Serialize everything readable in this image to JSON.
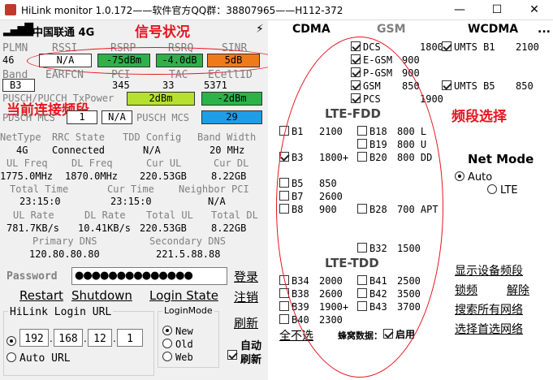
{
  "window": {
    "title": "HiLink monitor 1.0.172——软件官方QQ群：38807965——H112-372",
    "minimize": "—",
    "maximize": "☐",
    "close": "✕"
  },
  "status": {
    "signal": "▂▄▆█",
    "carrier": "中国联通 4G",
    "lightning": "⚡"
  },
  "annotations": {
    "signal": "信号状况",
    "band_current": "当前连接频段",
    "band_select": "频段选择"
  },
  "labels": {
    "plmn": "PLMN",
    "rssi": "RSSI",
    "rsrp": "RSRP",
    "rsrq": "RSRQ",
    "sinr": "SINR",
    "band": "Band",
    "earfcn": "EARFCN",
    "pci": "PCI",
    "tac": "TAC",
    "ecellid": "ECellID",
    "txpower": "PUSCH/PUCCH TxPower",
    "pdsch_mcs": "PDSCH MCS",
    "pusch_mcs": "PUSCH MCS",
    "nettype": "NetType",
    "rrc": "RRC State",
    "tdd": "TDD Config",
    "bandwidth": "Band Width",
    "ul_freq": "UL Freq",
    "dl_freq": "DL Freq",
    "cur_ul": "Cur UL",
    "cur_dl": "Cur DL",
    "total_time": "Total Time",
    "cur_time": "Cur Time",
    "neighbor": "Neighbor PCI",
    "ul_rate": "UL Rate",
    "dl_rate": "DL Rate",
    "total_ul": "Total UL",
    "total_dl": "Total DL",
    "primary_dns": "Primary DNS",
    "secondary_dns": "Secondary DNS",
    "password": "Password",
    "login_url": "HiLink Login URL",
    "login_mode": "LoginMode"
  },
  "values": {
    "plmn": "46",
    "rssi": "N/A",
    "rsrp": "-75dBm",
    "rsrq": "-4.0dB",
    "sinr": "5dB",
    "band": "B3",
    "earfcn": "",
    "pci": "345",
    "tac": "33",
    "ecellid": "5371",
    "tx1": "2dBm",
    "tx2": "-2dBm",
    "pdsch1": "1",
    "pdsch2": "N/A",
    "pusch_mcs": "29",
    "nettype": "4G",
    "rrc": "Connected",
    "tdd": "N/A",
    "bandwidth": "20 MHz",
    "ul_freq": "1775.0MHz",
    "dl_freq": "1870.0MHz",
    "cur_ul": "220.53GB",
    "cur_dl": "8.22GB",
    "total_time": "23:15:0",
    "cur_time": "23:15:0",
    "neighbor": "N/A",
    "ul_rate": "781.7KB/s",
    "dl_rate": "10.41KB/s",
    "total_ul": "220.53GB",
    "total_dl": "8.22GB",
    "primary_dns": "120.80.80.80",
    "secondary_dns": "221.5.88.88",
    "password": "●●●●●●●●●●●●●●",
    "ip1": "192",
    "ip2": "168",
    "ip3": "12",
    "ip4": "1"
  },
  "buttons": {
    "login": "登录",
    "logout": "注销",
    "refresh": "刷新",
    "auto_refresh": "自动刷新",
    "restart": "Restart",
    "shutdown": "Shutdown",
    "login_state": "Login State",
    "url_manual": "",
    "url_auto": "Auto URL",
    "mode_new": "New",
    "mode_old": "Old",
    "mode_web": "Web"
  },
  "right": {
    "cdma": "CDMA",
    "gsm": "GSM",
    "wcdma": "WCDMA",
    "more": "...",
    "gsm_bands": [
      {
        "name": "DCS",
        "freq": "1800"
      },
      {
        "name": "E-GSM",
        "freq": "900"
      },
      {
        "name": "P-GSM",
        "freq": "900"
      },
      {
        "name": "GSM",
        "freq": "850"
      },
      {
        "name": "PCS",
        "freq": "1900"
      }
    ],
    "wcdma_bands": [
      {
        "name": "UMTS B1",
        "freq": "2100"
      },
      {
        "name": "UMTS B5",
        "freq": "850"
      }
    ],
    "lte_fdd": "LTE-FDD",
    "fdd_left": [
      {
        "name": "B1",
        "freq": "2100"
      },
      {
        "name": "B3",
        "freq": "1800+"
      },
      {
        "name": "B5",
        "freq": "850"
      },
      {
        "name": "B7",
        "freq": "2600"
      },
      {
        "name": "B8",
        "freq": "900"
      }
    ],
    "fdd_right": [
      {
        "name": "B18",
        "freq": "800 L"
      },
      {
        "name": "B19",
        "freq": "800 U"
      },
      {
        "name": "B20",
        "freq": "800 DD"
      },
      {
        "name": "B28",
        "freq": "700 APT"
      },
      {
        "name": "B32",
        "freq": "1500"
      }
    ],
    "lte_tdd": "LTE-TDD",
    "tdd_left": [
      {
        "name": "B34",
        "freq": "2000"
      },
      {
        "name": "B38",
        "freq": "2600"
      },
      {
        "name": "B39",
        "freq": "1900+"
      },
      {
        "name": "B40",
        "freq": "2300"
      }
    ],
    "tdd_right": [
      {
        "name": "B41",
        "freq": "2500"
      },
      {
        "name": "B42",
        "freq": "3500"
      },
      {
        "name": "B43",
        "freq": "3700"
      }
    ],
    "deselect_all": "全不选",
    "cell_data": "蜂窝数据：",
    "enable": "启用",
    "net_mode": "Net Mode",
    "auto": "Auto",
    "lte": "LTE",
    "show_bands": "显示设备频段",
    "lock_band": "锁频",
    "unlock_band": "解除",
    "search_network": "搜索所有网络",
    "select_network": "选择首选网络"
  },
  "colors": {
    "green": "#2db24a",
    "yellow_green": "#b6e02f",
    "orange": "#f07a1a",
    "blue": "#1e9ee6",
    "annot_red": "#e8141f"
  }
}
